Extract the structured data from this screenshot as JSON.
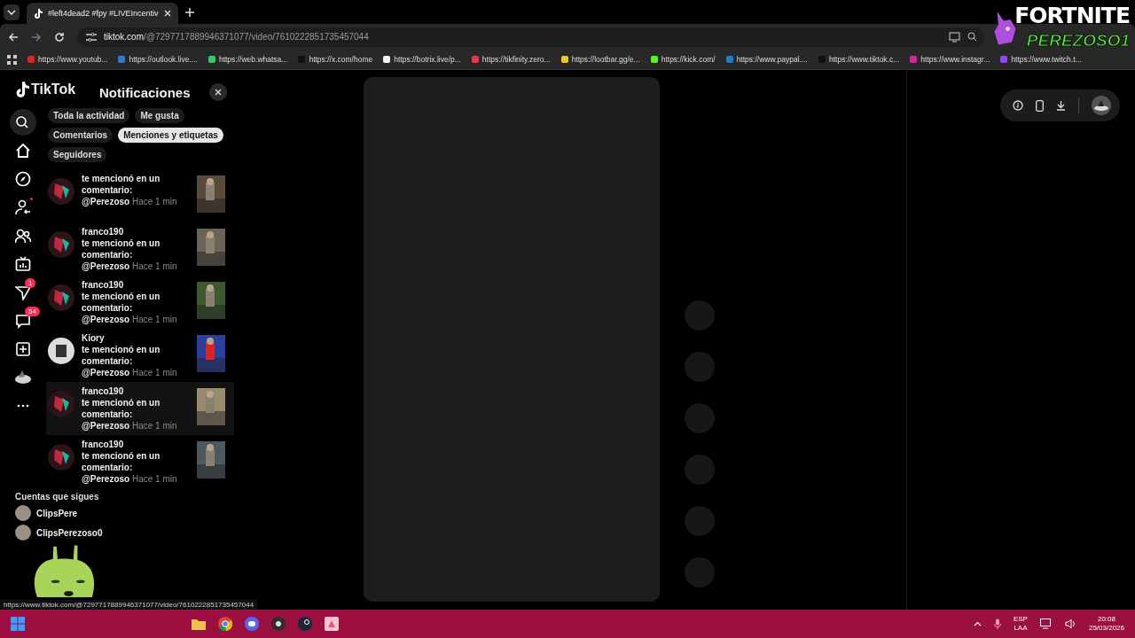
{
  "browser": {
    "tab_title": "#left4dead2 #fpy #LIVEIncentiv",
    "url_host": "tiktok.com",
    "url_path": "/@7297717889946371077/video/7610222851735457044",
    "bookmarks": [
      {
        "label": "https://www.youtub...",
        "color": "#e62117"
      },
      {
        "label": "https://outlook.live....",
        "color": "#2b7cd3"
      },
      {
        "label": "https://web.whatsa...",
        "color": "#25d366"
      },
      {
        "label": "https://x.com/home",
        "color": "#111111"
      },
      {
        "label": "https://botrix.live/p...",
        "color": "#f0f0f0"
      },
      {
        "label": "https://tikfinity.zero...",
        "color": "#e8384f"
      },
      {
        "label": "https://lootbar.gg/e...",
        "color": "#f5c518"
      },
      {
        "label": "https://kick.com/",
        "color": "#53fc18"
      },
      {
        "label": "https://www.paypal....",
        "color": "#1f7ad6"
      },
      {
        "label": "https://www.tiktok.c...",
        "color": "#111111"
      },
      {
        "label": "https://www.instagr...",
        "color": "#d6249f"
      },
      {
        "label": "https://www.twitch.t...",
        "color": "#9146ff"
      }
    ]
  },
  "overlay": {
    "line1": "FORTNITE",
    "line2": "PEREZOSO1"
  },
  "sidebar": {
    "logo": "TikTok",
    "items": [
      {
        "kind": "search"
      },
      {
        "kind": "home"
      },
      {
        "kind": "explore"
      },
      {
        "kind": "following",
        "unread": true
      },
      {
        "kind": "friends"
      },
      {
        "kind": "live"
      },
      {
        "kind": "messages",
        "badge": "1"
      },
      {
        "kind": "inbox",
        "badge": "54"
      },
      {
        "kind": "upload"
      },
      {
        "kind": "profile"
      },
      {
        "kind": "more"
      }
    ],
    "following_title": "Cuentas que sigues",
    "accounts": [
      {
        "name": "ClipsPere"
      },
      {
        "name": "ClipsPerezoso0"
      }
    ]
  },
  "notifications": {
    "title": "Notificaciones",
    "tabs": [
      {
        "label": "Toda la actividad",
        "selected": false
      },
      {
        "label": "Me gusta",
        "selected": false
      },
      {
        "label": "Comentarios",
        "selected": false
      },
      {
        "label": "Menciones y etiquetas",
        "selected": true
      },
      {
        "label": "Seguidores",
        "selected": false
      }
    ],
    "items": [
      {
        "text": "te mencionó en un comentario:",
        "mention": "@Perezoso",
        "time": "Hace 1 min",
        "hovered": false
      },
      {
        "user": "franco190",
        "text": "te mencionó en un comentario:",
        "mention": "@Perezoso",
        "time": "Hace 1 min",
        "hovered": false
      },
      {
        "user": "franco190",
        "text": "te mencionó en un comentario:",
        "mention": "@Perezoso",
        "time": "Hace 1 min",
        "hovered": false
      },
      {
        "user": "Kiory",
        "text": "te mencionó en un comentario:",
        "mention": "@Perezoso",
        "time": "Hace 1 min",
        "hovered": false
      },
      {
        "user": "franco190",
        "text": "te mencionó en un comentario:",
        "mention": "@Perezoso",
        "time": "Hace 1 min",
        "hovered": true
      },
      {
        "user": "franco190",
        "text": "te mencionó en un comentario:",
        "mention": "@Perezoso",
        "time": "Hace 1 min",
        "hovered": false
      }
    ]
  },
  "status_url": "https://www.tiktok.com/@7297717889946371077/video/7610222851735457044",
  "taskbar": {
    "lang": "ESP",
    "layout": "LAA",
    "time": "20:08",
    "date": "25/03/2026"
  }
}
